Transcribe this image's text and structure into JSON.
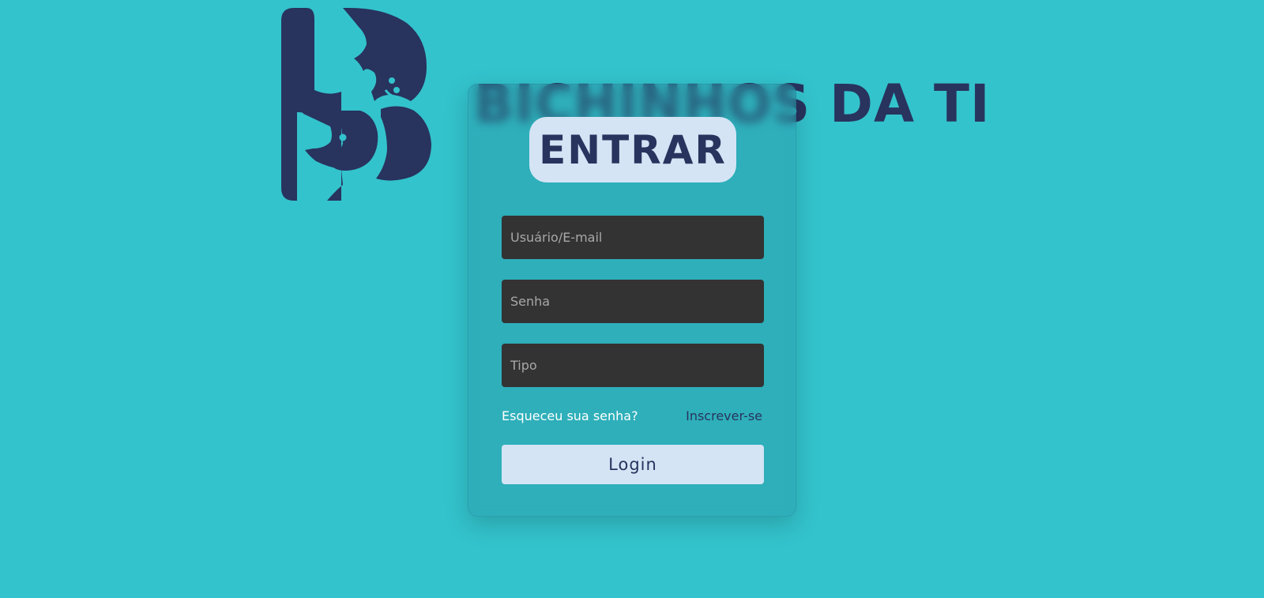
{
  "brand": {
    "name": "BICHINHOS DA TI",
    "logo_icon": "bichinhos-b-animals-logo"
  },
  "login_form": {
    "title": "ENTRAR",
    "username_placeholder": "Usuário/E-mail",
    "password_placeholder": "Senha",
    "type_placeholder": "Tipo",
    "forgot_password_label": "Esqueceu sua senha?",
    "signup_label": "Inscrever-se",
    "login_button_label": "Login"
  },
  "colors": {
    "background": "#33c3cc",
    "brand_navy": "#28335e",
    "pill_light": "#d4e4f4",
    "input_dark": "#333333"
  }
}
